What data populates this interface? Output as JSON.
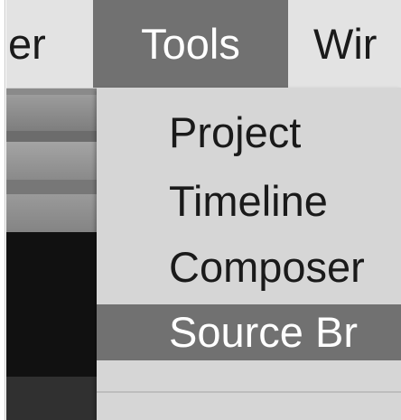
{
  "menubar": {
    "items": [
      {
        "label": "er"
      },
      {
        "label": "Tools"
      },
      {
        "label": "Wir"
      }
    ]
  },
  "tools_menu": {
    "items": [
      {
        "label": "Project"
      },
      {
        "label": "Timeline"
      },
      {
        "label": "Composer"
      },
      {
        "label": "Source Br"
      }
    ]
  },
  "colors": {
    "menu_bg": "#d6d6d6",
    "highlight": "#717171",
    "menubar_bg": "#e3e3e3"
  }
}
